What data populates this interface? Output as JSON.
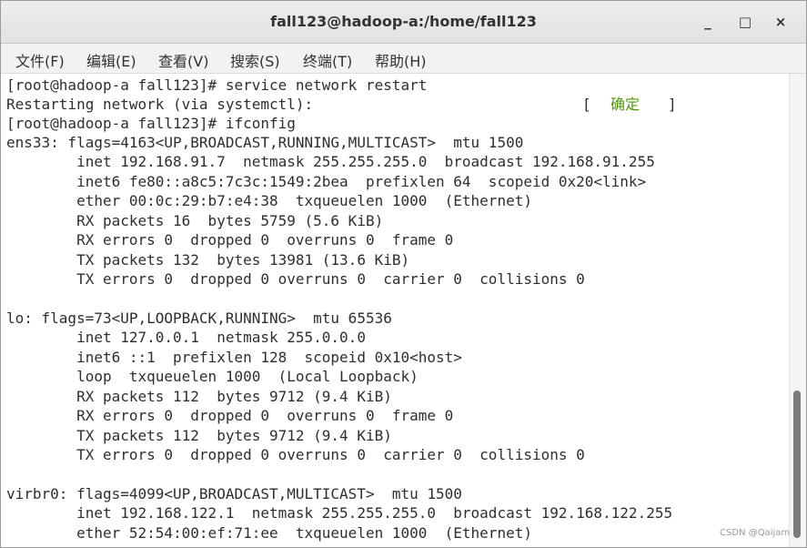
{
  "window": {
    "title": "fall123@hadoop-a:/home/fall123",
    "minimize_glyph": "_",
    "maximize_glyph": "□",
    "close_glyph": "×"
  },
  "menu": {
    "file": "文件(F)",
    "edit": "编辑(E)",
    "view": "查看(V)",
    "search": "搜索(S)",
    "terminal": "终端(T)",
    "help": "帮助(H)"
  },
  "terminal": {
    "lines": [
      "[root@hadoop-a fall123]# service network restart",
      "Restarting network (via systemctl):",
      "[root@hadoop-a fall123]# ifconfig",
      "ens33: flags=4163<UP,BROADCAST,RUNNING,MULTICAST>  mtu 1500",
      "        inet 192.168.91.7  netmask 255.255.255.0  broadcast 192.168.91.255",
      "        inet6 fe80::a8c5:7c3c:1549:2bea  prefixlen 64  scopeid 0x20<link>",
      "        ether 00:0c:29:b7:e4:38  txqueuelen 1000  (Ethernet)",
      "        RX packets 16  bytes 5759 (5.6 KiB)",
      "        RX errors 0  dropped 0  overruns 0  frame 0",
      "        TX packets 132  bytes 13981 (13.6 KiB)",
      "        TX errors 0  dropped 0 overruns 0  carrier 0  collisions 0",
      "",
      "lo: flags=73<UP,LOOPBACK,RUNNING>  mtu 65536",
      "        inet 127.0.0.1  netmask 255.0.0.0",
      "        inet6 ::1  prefixlen 128  scopeid 0x10<host>",
      "        loop  txqueuelen 1000  (Local Loopback)",
      "        RX packets 112  bytes 9712 (9.4 KiB)",
      "        RX errors 0  dropped 0  overruns 0  frame 0",
      "        TX packets 112  bytes 9712 (9.4 KiB)",
      "        TX errors 0  dropped 0 overruns 0  carrier 0  collisions 0",
      "",
      "virbr0: flags=4099<UP,BROADCAST,MULTICAST>  mtu 1500",
      "        inet 192.168.122.1  netmask 255.255.255.0  broadcast 192.168.122.255",
      "        ether 52:54:00:ef:71:ee  txqueuelen 1000  (Ethernet)"
    ],
    "status_open_bracket": "[",
    "status_ok": "确定",
    "status_close_bracket": "]"
  },
  "watermark": "CSDN @Qaijam",
  "colors": {
    "ok_green": "#4e9a06",
    "text": "#2e2e2e",
    "background": "#ffffff"
  }
}
